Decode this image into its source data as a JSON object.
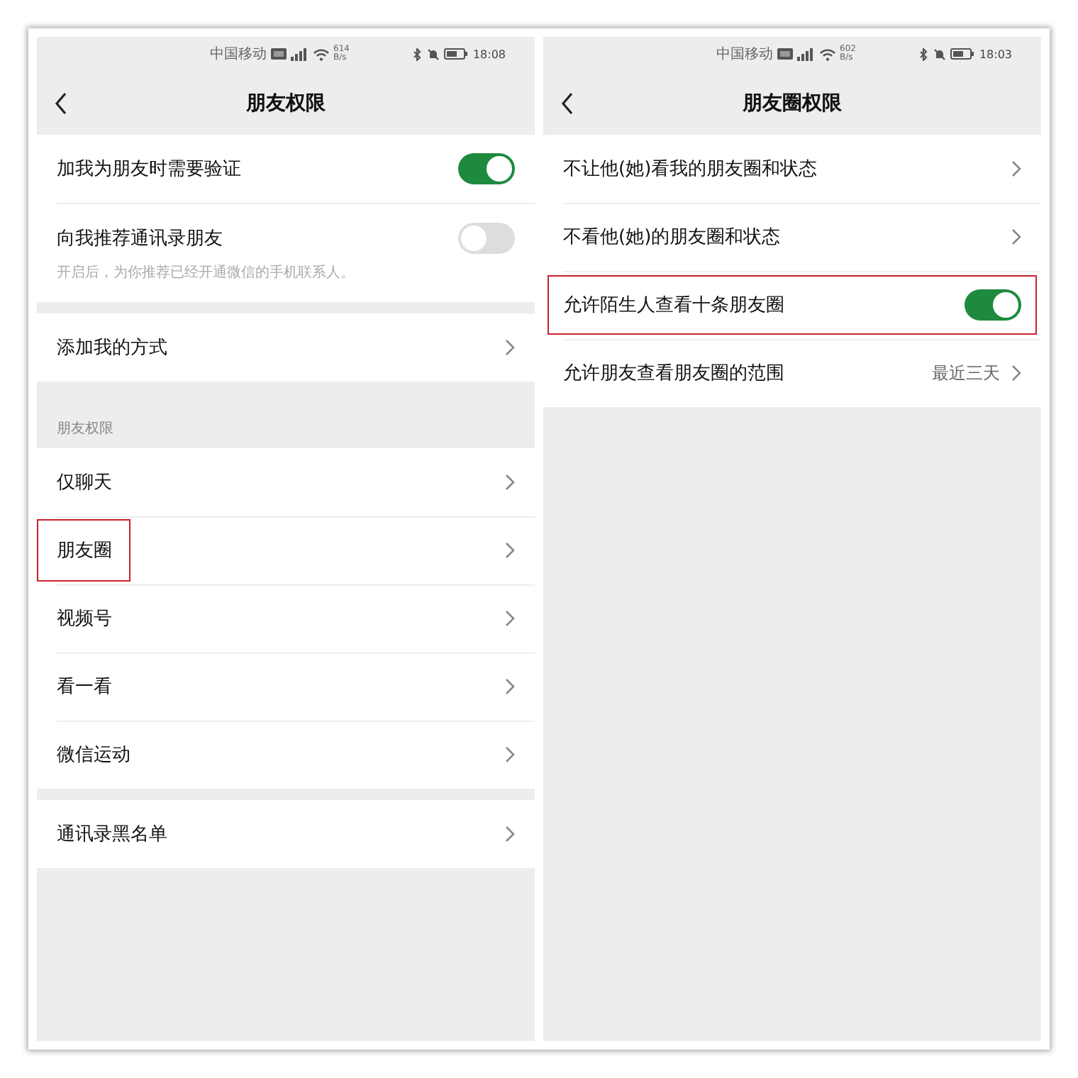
{
  "screens": [
    {
      "status_bar": {
        "carrier": "中国移动",
        "speed": "614",
        "speed_unit": "B/s",
        "time": "18:08"
      },
      "title": "朋友权限",
      "groups": [
        {
          "items": [
            {
              "kind": "toggle",
              "label": "加我为朋友时需要验证",
              "on": true
            },
            {
              "kind": "toggle",
              "label": "向我推荐通讯录朋友",
              "on": false,
              "subtitle": "开启后，为你推荐已经开通微信的手机联系人。"
            }
          ]
        },
        {
          "items": [
            {
              "kind": "link",
              "label": "添加我的方式"
            }
          ]
        },
        {
          "header": "朋友权限",
          "items": [
            {
              "kind": "link",
              "label": "仅聊天"
            },
            {
              "kind": "link",
              "label": "朋友圈",
              "label_outlined": true
            },
            {
              "kind": "link",
              "label": "视频号"
            },
            {
              "kind": "link",
              "label": "看一看"
            },
            {
              "kind": "link",
              "label": "微信运动"
            }
          ]
        },
        {
          "items": [
            {
              "kind": "link",
              "label": "通讯录黑名单"
            }
          ]
        }
      ]
    },
    {
      "status_bar": {
        "carrier": "中国移动",
        "speed": "602",
        "speed_unit": "B/s",
        "time": "18:03"
      },
      "title": "朋友圈权限",
      "groups": [
        {
          "items": [
            {
              "kind": "link",
              "label": "不让他(她)看我的朋友圈和状态"
            },
            {
              "kind": "link",
              "label": "不看他(她)的朋友圈和状态"
            },
            {
              "kind": "toggle",
              "label": "允许陌生人查看十条朋友圈",
              "on": true,
              "row_outlined": true
            },
            {
              "kind": "link",
              "label": "允许朋友查看朋友圈的范围",
              "value": "最近三天"
            }
          ]
        }
      ]
    }
  ]
}
